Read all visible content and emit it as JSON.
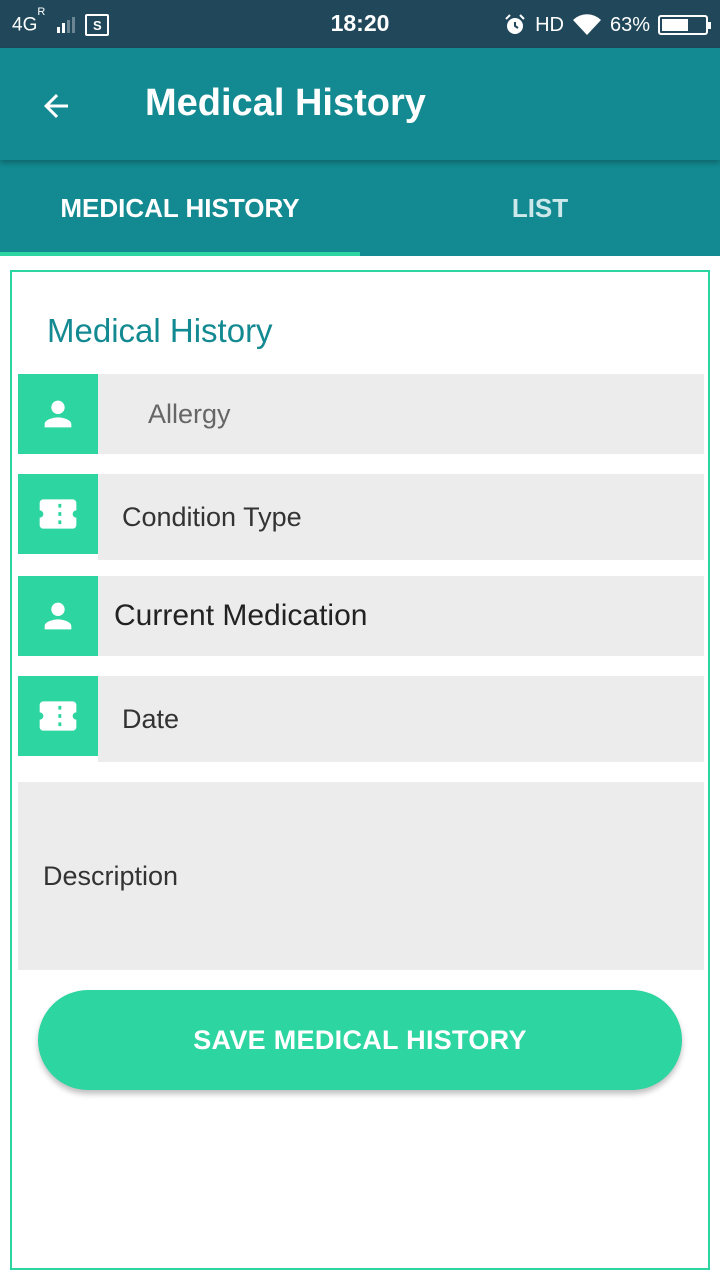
{
  "status_bar": {
    "network": "4G",
    "roaming": "R",
    "time": "18:20",
    "hd": "HD",
    "battery": "63%",
    "battery_level": 0.63
  },
  "app_bar": {
    "title": "Medical History",
    "back_icon": "arrow-left-icon"
  },
  "tabs": [
    {
      "label": "MEDICAL HISTORY",
      "active": true
    },
    {
      "label": "LIST",
      "active": false
    }
  ],
  "form": {
    "heading": "Medical History",
    "fields": [
      {
        "placeholder": "Allergy",
        "icon": "person-icon"
      },
      {
        "placeholder": "Condition Type",
        "icon": "ticket-icon"
      },
      {
        "value": "Current Medication",
        "icon": "person-icon"
      },
      {
        "placeholder": "Date",
        "icon": "ticket-icon"
      }
    ],
    "description_placeholder": "Description",
    "save_label": "SAVE MEDICAL HISTORY"
  },
  "colors": {
    "status_bar": "#20485a",
    "primary": "#138a91",
    "accent": "#2dd5a0",
    "field_bg": "#ececec"
  }
}
